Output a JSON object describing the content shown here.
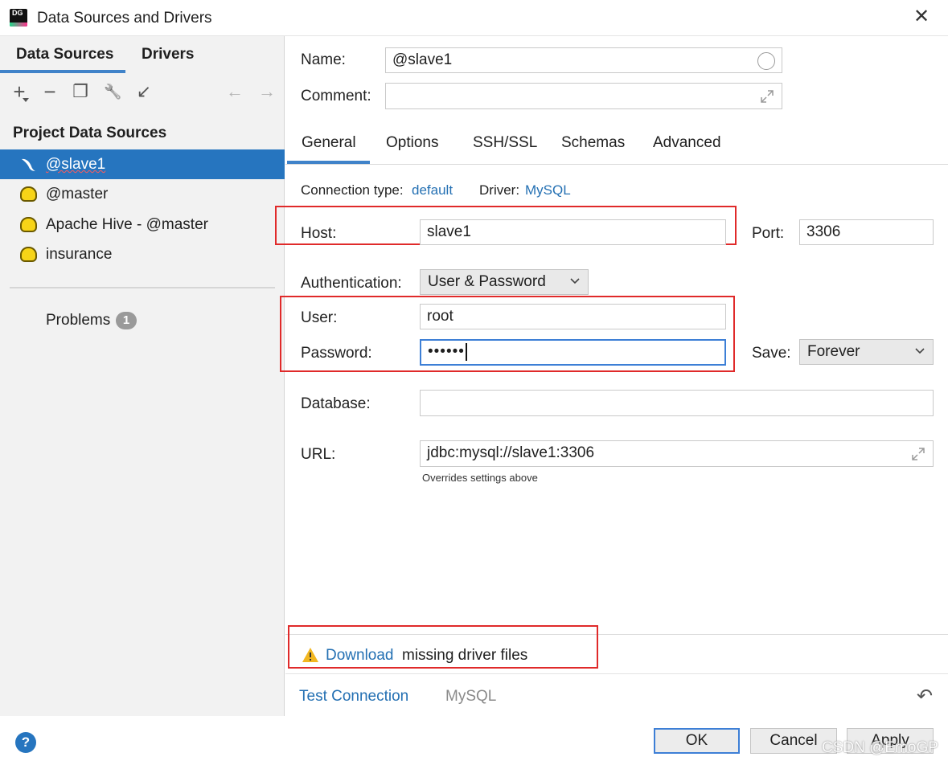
{
  "window": {
    "title": "Data Sources and Drivers",
    "app_badge": "DG",
    "close_glyph": "✕"
  },
  "sidebar": {
    "tabs": [
      "Data Sources",
      "Drivers"
    ],
    "toolbar_glyphs": {
      "add": "+",
      "remove": "−",
      "copy": "❐",
      "wrench": "🔧",
      "import": "↙",
      "back": "←",
      "forward": "→"
    },
    "section_title": "Project Data Sources",
    "items": [
      {
        "label": "@slave1",
        "icon": "mysql-dolphin-icon",
        "selected": true
      },
      {
        "label": "@master",
        "icon": "hive-icon"
      },
      {
        "label": "Apache Hive - @master",
        "icon": "hive-icon"
      },
      {
        "label": "insurance",
        "icon": "hive-icon"
      }
    ],
    "problems_label": "Problems",
    "problems_count": "1"
  },
  "form": {
    "name_label": "Name:",
    "name_value": "@slave1",
    "comment_label": "Comment:",
    "comment_value": "",
    "tabs": [
      "General",
      "Options",
      "SSH/SSL",
      "Schemas",
      "Advanced"
    ],
    "active_tab": "General",
    "connection_type_label": "Connection type:",
    "connection_type_value": "default",
    "driver_label": "Driver:",
    "driver_value": "MySQL",
    "host_label": "Host:",
    "host_value": "slave1",
    "port_label": "Port:",
    "port_value": "3306",
    "auth_label": "Authentication:",
    "auth_value": "User & Password",
    "user_label": "User:",
    "user_value": "root",
    "password_label": "Password:",
    "password_value": "••••••",
    "save_label": "Save:",
    "save_value": "Forever",
    "database_label": "Database:",
    "database_value": "",
    "url_label": "URL:",
    "url_value": "jdbc:mysql://slave1:3306",
    "url_hint": "Overrides settings above"
  },
  "notice": {
    "icon": "warning-icon",
    "link_text": "Download",
    "text": "missing driver files"
  },
  "footer": {
    "test_connection": "Test Connection",
    "driver_name": "MySQL",
    "revert_glyph": "↶",
    "help_glyph": "?",
    "ok": "OK",
    "cancel": "Cancel",
    "apply": "Apply"
  },
  "watermark": "CSDN @EmoGP",
  "colors": {
    "accent": "#2675bf",
    "link": "#2470b3",
    "highlight_box": "#e02a2a",
    "warning": "#f2b720"
  }
}
